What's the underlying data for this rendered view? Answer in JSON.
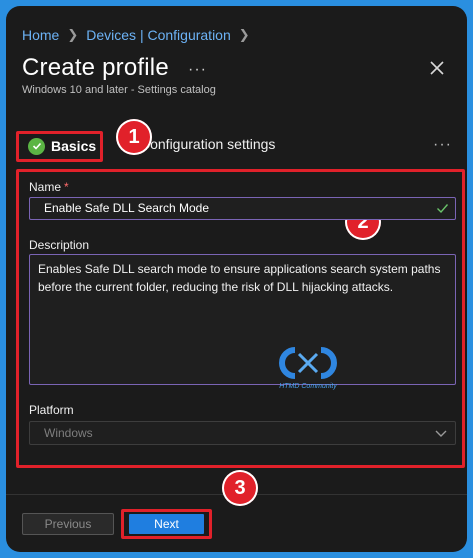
{
  "breadcrumb": {
    "items": [
      "Home",
      "Devices | Configuration"
    ]
  },
  "header": {
    "title": "Create profile",
    "more": "···",
    "subtitle": "Windows 10 and later - Settings catalog"
  },
  "tabs": {
    "basics": "Basics",
    "configuration": "Configuration settings",
    "more": "···"
  },
  "badges": [
    "1",
    "2",
    "3"
  ],
  "form": {
    "name_label": "Name",
    "required_mark": "*",
    "name_value": "Enable Safe DLL Search Mode",
    "description_label": "Description",
    "description_value": "Enables Safe DLL search mode to ensure applications search system paths before the current folder, reducing the risk of DLL hijacking attacks.",
    "platform_label": "Platform",
    "platform_value": "Windows"
  },
  "watermark": {
    "text": "HTMD Community"
  },
  "footer": {
    "previous_label": "Previous",
    "next_label": "Next"
  },
  "colors": {
    "accent": "#1f7ee0",
    "highlight_red": "#e1212a",
    "success_green": "#5bb544",
    "link_blue": "#6cb2f5"
  }
}
